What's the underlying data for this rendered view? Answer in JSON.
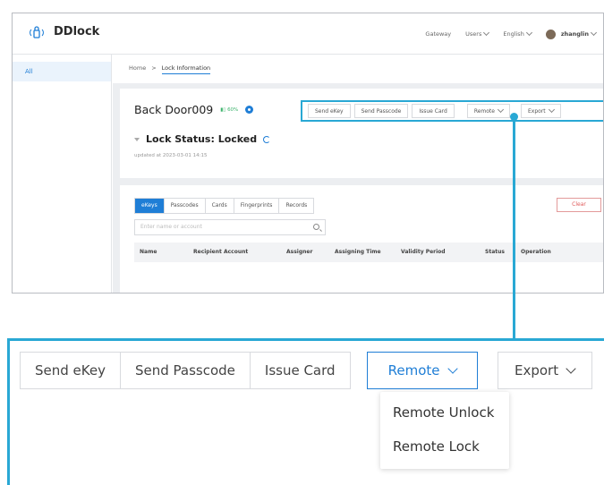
{
  "app": {
    "logo_text": "DDlock"
  },
  "topnav": {
    "gateway": "Gateway",
    "users": "Users",
    "language": "English",
    "user_name": "zhanglin"
  },
  "sidebar": {
    "items": [
      {
        "label": "All"
      }
    ]
  },
  "breadcrumb": {
    "home": "Home",
    "separator": ">",
    "current": "Lock Information"
  },
  "lock": {
    "name": "Back Door009",
    "battery": "60%",
    "status": "Lock Status: Locked",
    "updated": "updated at 2023-03-01 14:15"
  },
  "toolbar": {
    "send_ekey": "Send eKey",
    "send_passcode": "Send Passcode",
    "issue_card": "Issue Card",
    "remote": "Remote",
    "export": "Export"
  },
  "tabs": [
    "eKeys",
    "Passcodes",
    "Cards",
    "Fingerprints",
    "Records"
  ],
  "clear_label": "Clear",
  "search": {
    "placeholder": "Enter name or account"
  },
  "table": {
    "columns": [
      "Name",
      "Recipient Account",
      "Assigner",
      "Assigning Time",
      "Validity Period",
      "Status",
      "Operation"
    ]
  },
  "remote_menu": {
    "items": [
      "Remote Unlock",
      "Remote Lock"
    ]
  },
  "colors": {
    "accent": "#1f7ed6",
    "highlight": "#29a8d4",
    "battery": "#3bb36b",
    "danger": "#e05a5a"
  }
}
